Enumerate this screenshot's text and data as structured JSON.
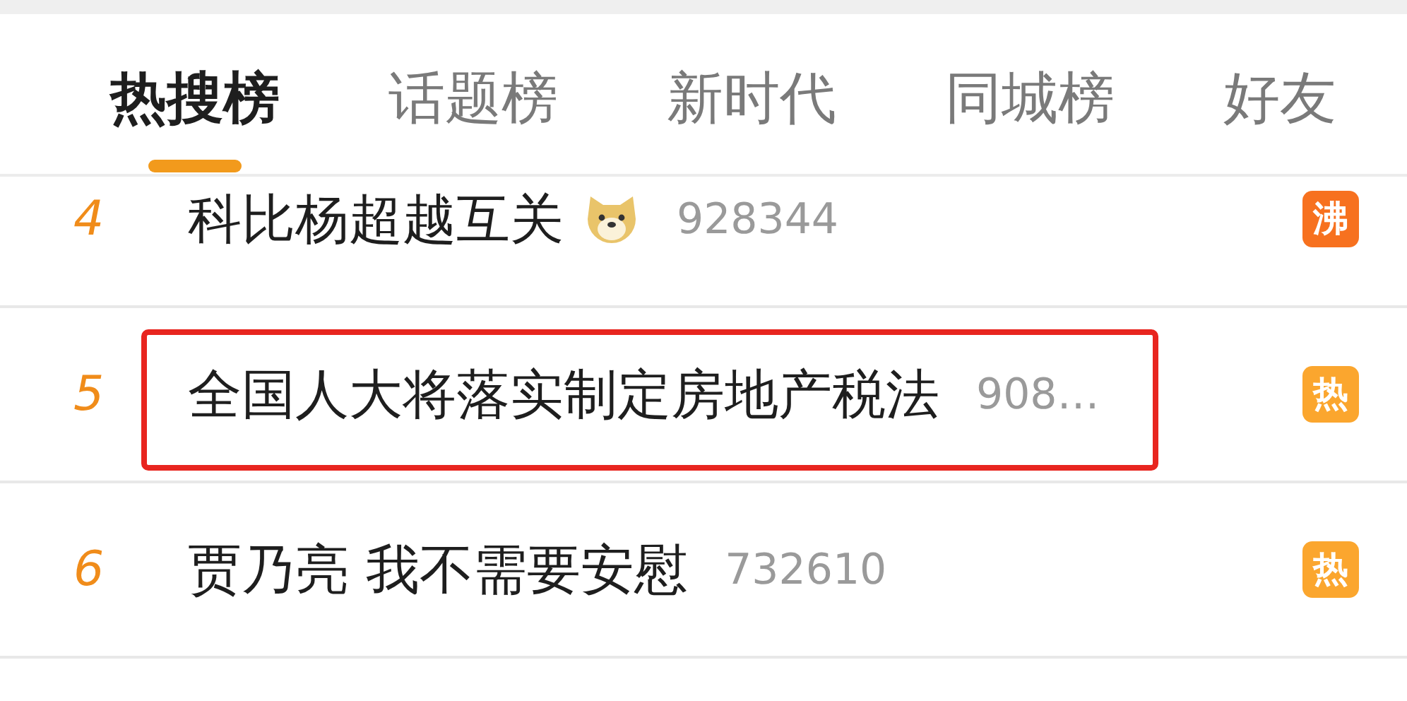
{
  "tabs": [
    {
      "label": "热搜榜",
      "selected": true
    },
    {
      "label": "话题榜",
      "selected": false
    },
    {
      "label": "新时代",
      "selected": false
    },
    {
      "label": "同城榜",
      "selected": false
    },
    {
      "label": "好友",
      "selected": false
    }
  ],
  "rows": [
    {
      "rank": "4",
      "title": "科比杨超越互关",
      "has_emoji": true,
      "count": "928344",
      "highlighted": false,
      "badge": {
        "text": "沸",
        "color": "#f7711f"
      }
    },
    {
      "rank": "5",
      "title": "全国人大将落实制定房地产税法",
      "has_emoji": false,
      "count": "908…",
      "highlighted": true,
      "badge": {
        "text": "热",
        "color": "#fba62e"
      }
    },
    {
      "rank": "6",
      "title": "贾乃亮 我不需要安慰",
      "has_emoji": false,
      "count": "732610",
      "highlighted": false,
      "badge": {
        "text": "热",
        "color": "#fba62e"
      }
    }
  ]
}
